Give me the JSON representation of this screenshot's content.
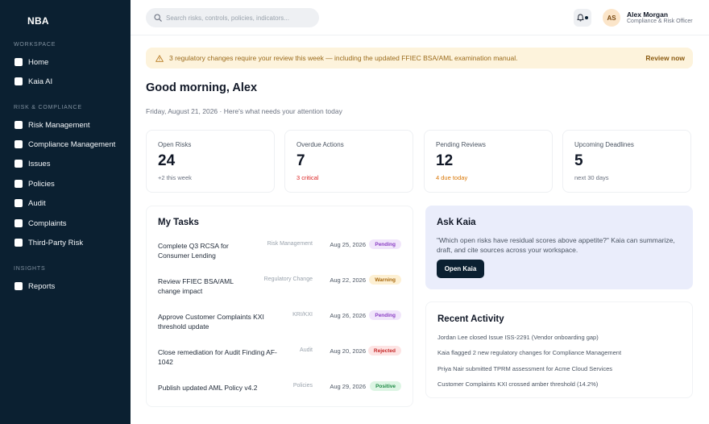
{
  "brand": "NBA",
  "sidebar": {
    "sections": [
      {
        "title": "WORKSPACE",
        "items": [
          {
            "label": "Home"
          },
          {
            "label": "Kaia AI"
          }
        ]
      },
      {
        "title": "RISK & COMPLIANCE",
        "items": [
          {
            "label": "Risk Management"
          },
          {
            "label": "Compliance Management"
          },
          {
            "label": "Issues"
          },
          {
            "label": "Policies"
          },
          {
            "label": "Audit"
          },
          {
            "label": "Complaints"
          },
          {
            "label": "Third-Party Risk"
          }
        ]
      },
      {
        "title": "INSIGHTS",
        "items": [
          {
            "label": "Reports"
          }
        ]
      }
    ]
  },
  "search": {
    "placeholder": "Search risks, controls, policies, indicators..."
  },
  "user": {
    "initials": "AS",
    "name": "Alex Morgan",
    "role": "Compliance & Risk Officer"
  },
  "banner": {
    "text": "3 regulatory changes require your review this week — including the updated FFIEC BSA/AML examination manual.",
    "action": "Review now"
  },
  "greeting": "Good morning, Alex",
  "subline": "Friday, August 21, 2026 · Here's what needs your attention today",
  "stats": [
    {
      "label": "Open Risks",
      "value": "24",
      "note": "+2 this week",
      "note_color": "#6b7280"
    },
    {
      "label": "Overdue Actions",
      "value": "7",
      "note": "3 critical",
      "note_color": "#dc2626"
    },
    {
      "label": "Pending Reviews",
      "value": "12",
      "note": "4 due today",
      "note_color": "#d97706"
    },
    {
      "label": "Upcoming Deadlines",
      "value": "5",
      "note": "next 30 days",
      "note_color": "#6b7280"
    }
  ],
  "tasks": {
    "title": "My Tasks",
    "items": [
      {
        "title": "Complete Q3 RCSA for Consumer Lending",
        "category": "Risk Management",
        "date": "Aug 25, 2026",
        "status": "Pending",
        "status_bg": "#f1e6fb",
        "status_fg": "#8b3fc4"
      },
      {
        "title": "Review FFIEC BSA/AML change impact",
        "category": "Regulatory Change",
        "date": "Aug 22, 2026",
        "status": "Warning",
        "status_bg": "#fdf0d3",
        "status_fg": "#a9690f"
      },
      {
        "title": "Approve Customer Complaints KXI threshold update",
        "category": "KRI/KXI",
        "date": "Aug 26, 2026",
        "status": "Pending",
        "status_bg": "#f1e6fb",
        "status_fg": "#8b3fc4"
      },
      {
        "title": "Close remediation for Audit Finding AF-1042",
        "category": "Audit",
        "date": "Aug 20, 2026",
        "status": "Rejected",
        "status_bg": "#fde4e4",
        "status_fg": "#c62828"
      },
      {
        "title": "Publish updated AML Policy v4.2",
        "category": "Policies",
        "date": "Aug 29, 2026",
        "status": "Positive",
        "status_bg": "#ddf5e4",
        "status_fg": "#1e8a45"
      }
    ]
  },
  "ask": {
    "title": "Ask Kaia",
    "description": "\"Which open risks have residual scores above appetite?\" Kaia can summarize, draft, and cite sources across your workspace.",
    "button": "Open Kaia"
  },
  "activity": {
    "title": "Recent Activity",
    "items": [
      "Jordan Lee closed Issue ISS-2291 (Vendor onboarding gap)",
      "Kaia flagged 2 new regulatory changes for Compliance Management",
      "Priya Nair submitted TPRM assessment for Acme Cloud Services",
      "Customer Complaints KXI crossed amber threshold (14.2%)"
    ]
  },
  "icons": {
    "search": "search-icon",
    "bell": "bell-icon",
    "warning": "warning-triangle-icon"
  },
  "colors": {
    "sidebar_bg": "#0b2031",
    "banner_bg": "#fdf3dc",
    "ask_bg": "#eaedfb",
    "accent_dark": "#0b2031"
  }
}
